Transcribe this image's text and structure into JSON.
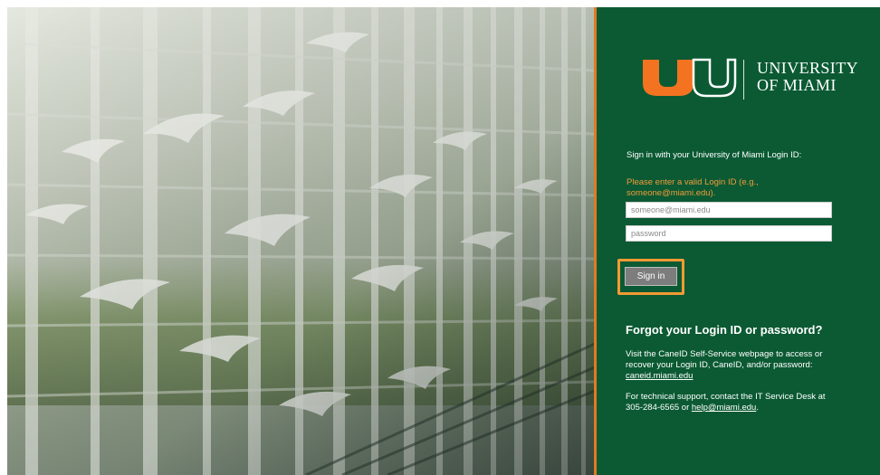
{
  "hero": {
    "image": "atrium-with-hanging-bird-sculptures"
  },
  "logo": {
    "mark": "U",
    "line1": "UNIVERSITY",
    "line2": "OF MIAMI",
    "colors": {
      "orange": "#f47321",
      "green": "#005030"
    }
  },
  "login": {
    "prompt": "Sign in with your University of Miami Login ID:",
    "error": "Please enter a valid Login ID (e.g., someone@miami.edu).",
    "username_placeholder": "someone@miami.edu",
    "password_placeholder": "password",
    "signin_label": "Sign in"
  },
  "help": {
    "heading": "Forgot your Login ID or password?",
    "p1_text": "Visit the CaneID Self-Service webpage to access or recover your Login ID, CaneID, and/or password: ",
    "p1_link": "caneid.miami.edu",
    "p2_text": "For technical support, contact the IT Service Desk at 305-284-6565 or ",
    "p2_link": "help@miami.edu",
    "p2_end": "."
  },
  "colors": {
    "panel_bg": "#0b5a33",
    "accent_orange": "#e07b22",
    "error_text": "#f29b3c",
    "highlight_border": "#f39a34"
  }
}
